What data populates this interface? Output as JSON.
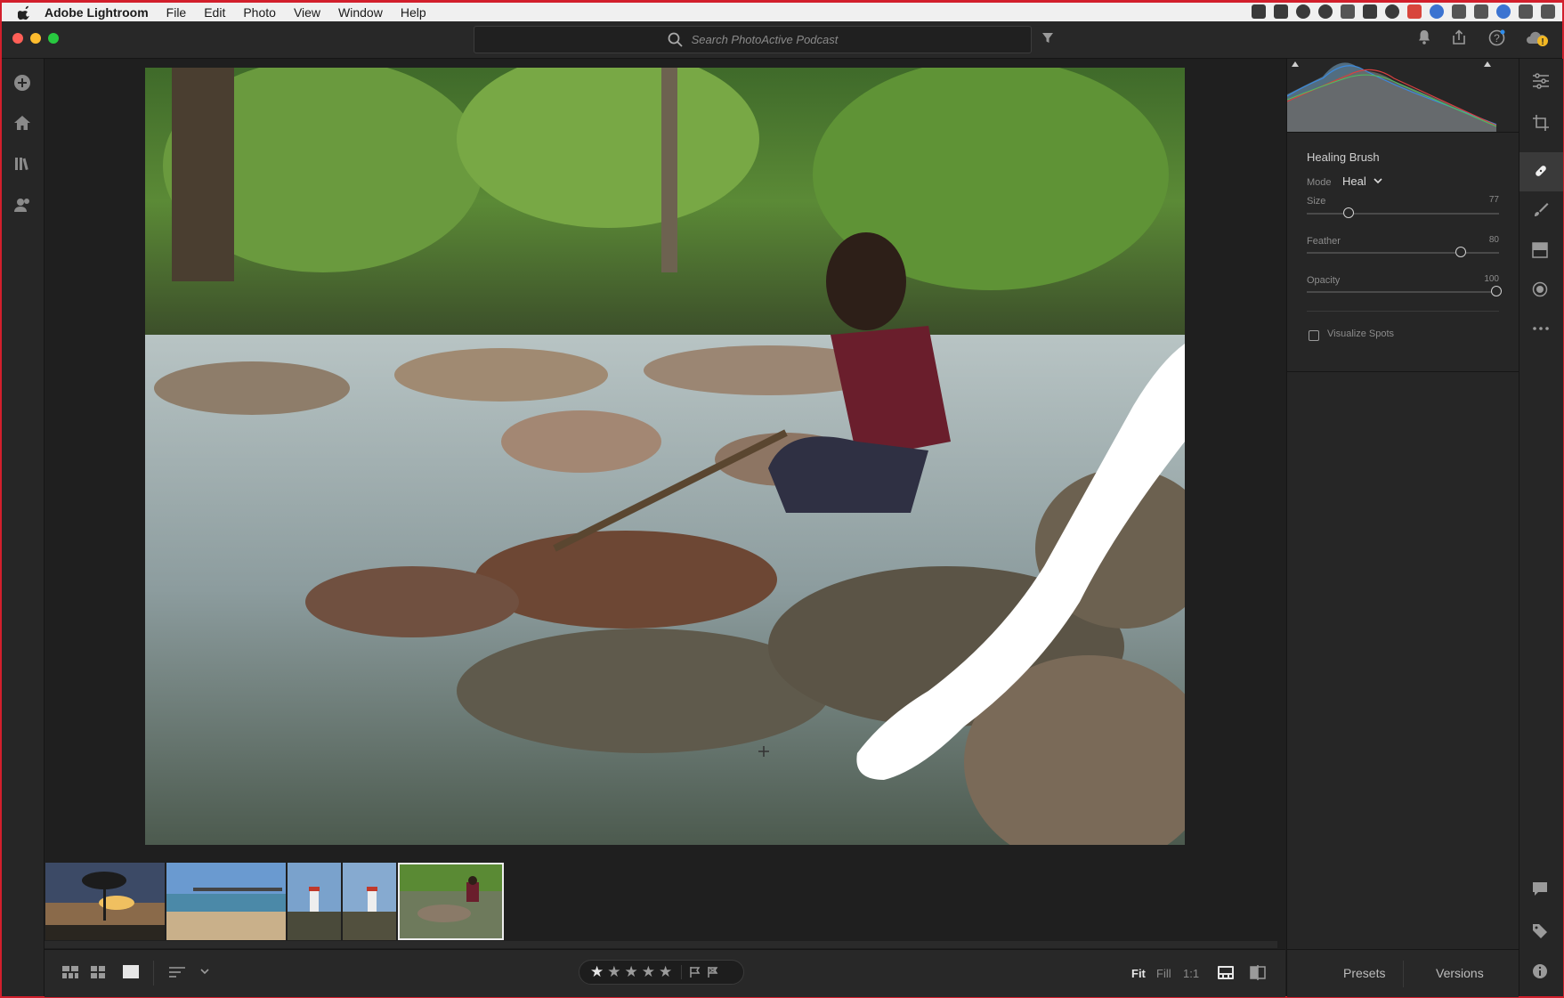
{
  "menubar": {
    "app_name": "Adobe Lightroom",
    "items": [
      "File",
      "Edit",
      "Photo",
      "View",
      "Window",
      "Help"
    ]
  },
  "search": {
    "placeholder": "Search PhotoActive Podcast"
  },
  "healing_brush": {
    "title": "Healing Brush",
    "mode_label": "Mode",
    "mode_value": "Heal",
    "size_label": "Size",
    "size_value": "77",
    "feather_label": "Feather",
    "feather_value": "80",
    "opacity_label": "Opacity",
    "opacity_value": "100",
    "visualize_spots_label": "Visualize Spots",
    "visualize_spots_checked": false
  },
  "bottombar": {
    "fit_label": "Fit",
    "fill_label": "Fill",
    "one_to_one_label": "1:1",
    "rating": 0,
    "max_rating": 5
  },
  "right_bottom_tabs": {
    "presets": "Presets",
    "versions": "Versions"
  },
  "filmstrip": {
    "thumbnails": [
      "tree-sunset-thumbnail",
      "beach-pier-thumbnail",
      "lighthouse-thumbnail-1",
      "lighthouse-thumbnail-2",
      "river-woman-thumbnail"
    ],
    "selected": "river-woman-thumbnail"
  },
  "icons": {
    "left_rail": [
      "add-photos-icon",
      "home-icon",
      "library-icon",
      "people-icon"
    ],
    "right_rail": [
      "edit-sliders-icon",
      "crop-icon",
      "healing-brush-icon",
      "brush-icon",
      "linear-gradient-icon",
      "radial-gradient-icon",
      "more-icon",
      "comments-icon",
      "keywords-icon",
      "info-icon"
    ]
  },
  "colors": {
    "accent_red": "#d21f2c",
    "panel_bg": "#262626",
    "canvas_bg": "#1f1f1f"
  }
}
